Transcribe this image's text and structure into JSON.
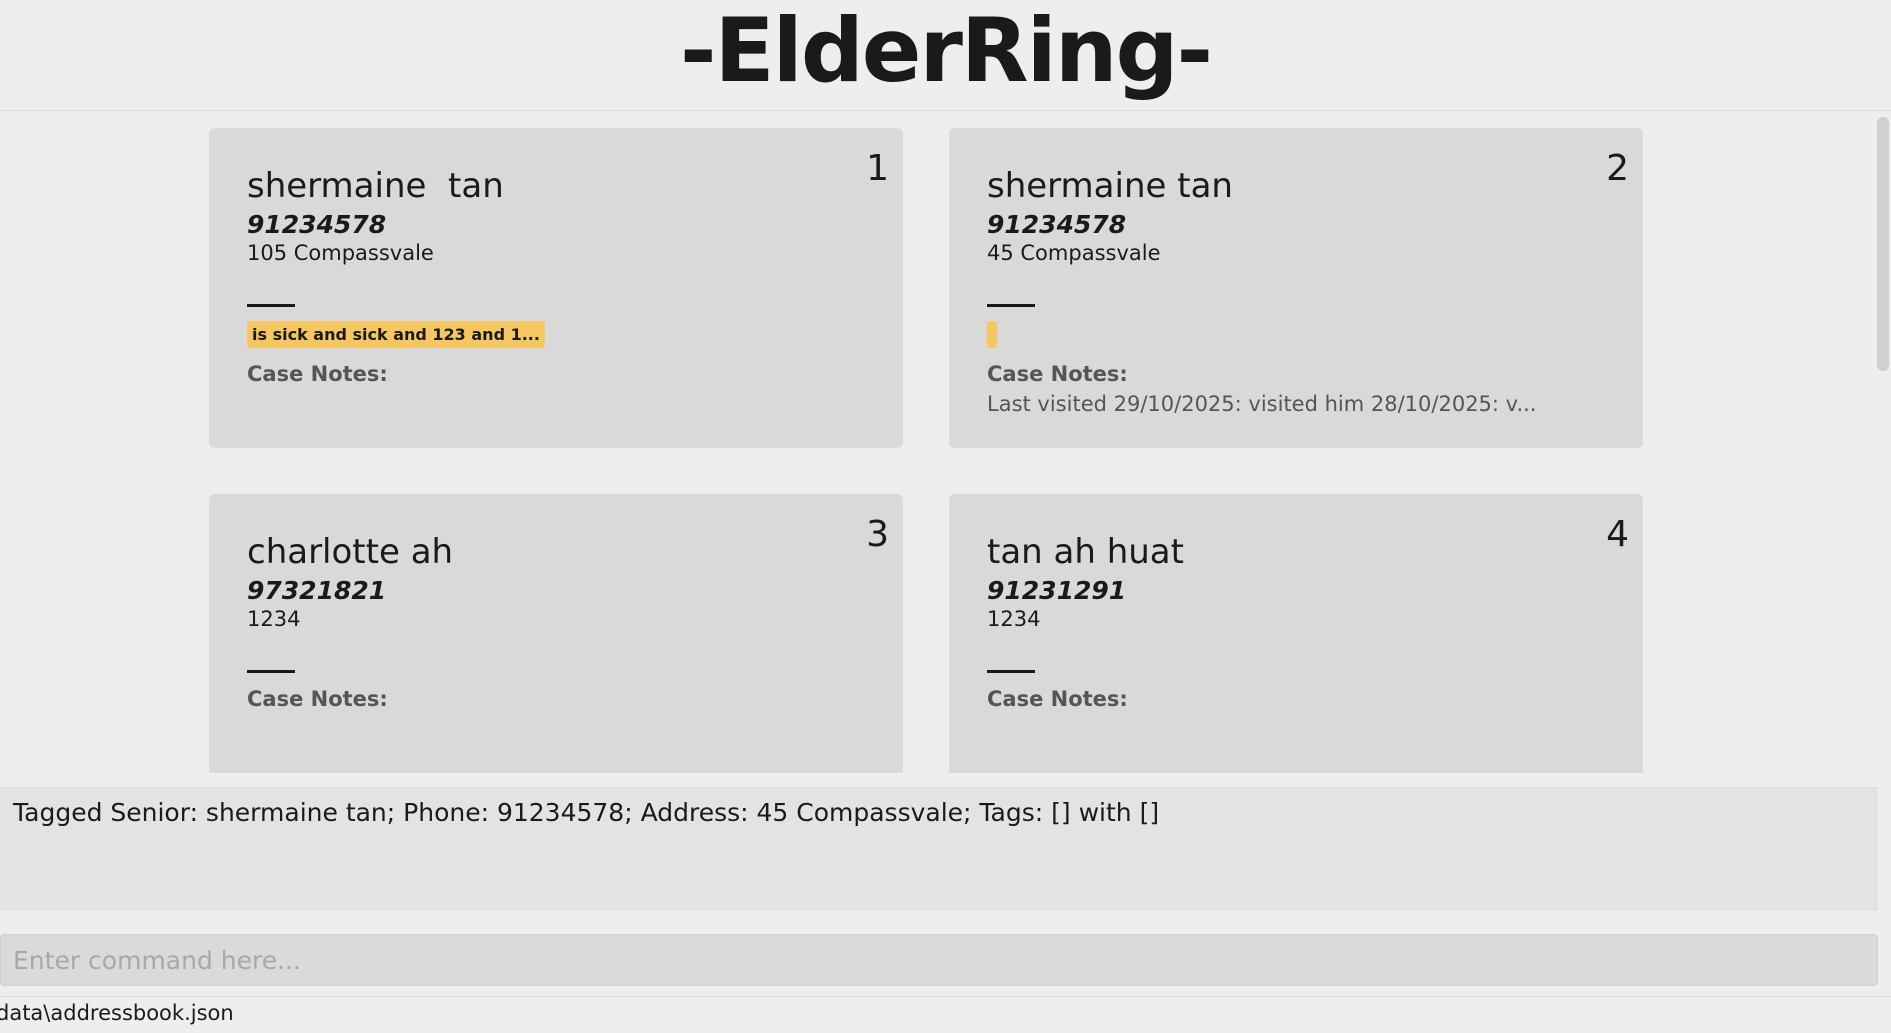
{
  "app": {
    "title": "-ElderRing-"
  },
  "persons": [
    {
      "index": "1",
      "name": "shermaine  tan",
      "phone": "91234578",
      "address": "105 Compassvale",
      "tags": [
        "is sick and sick and 123 and 1..."
      ],
      "notes_label": "Case Notes:",
      "notes": ""
    },
    {
      "index": "2",
      "name": "shermaine tan",
      "phone": "91234578",
      "address": "45 Compassvale",
      "tags": [
        ""
      ],
      "notes_label": "Case Notes:",
      "notes": "Last visited 29/10/2025: visited him 28/10/2025: v..."
    },
    {
      "index": "3",
      "name": "charlotte ah",
      "phone": "97321821",
      "address": "1234",
      "tags": [],
      "notes_label": "Case Notes:",
      "notes": ""
    },
    {
      "index": "4",
      "name": "tan ah huat",
      "phone": "91231291",
      "address": "1234",
      "tags": [],
      "notes_label": "Case Notes:",
      "notes": ""
    }
  ],
  "result_display": {
    "text": "Tagged Senior: shermaine tan; Phone: 91234578; Address: 45 Compassvale; Tags: [] with []"
  },
  "command_box": {
    "placeholder": "Enter command here...",
    "value": ""
  },
  "status_bar": {
    "file_path": "data\\addressbook.json"
  },
  "colors": {
    "background": "#eeeeee",
    "card": "#d9d9d9",
    "tag": "#f5c762",
    "text": "#1a1a1a",
    "muted_text": "#555555"
  }
}
